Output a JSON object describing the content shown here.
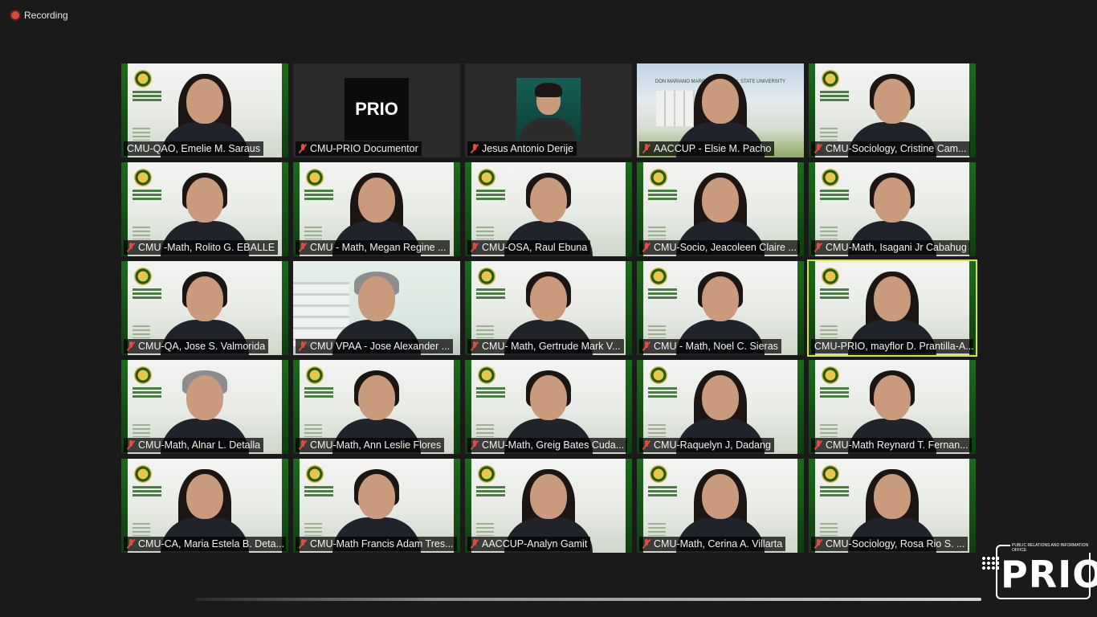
{
  "recording": {
    "label": "Recording"
  },
  "participants": [
    {
      "name": "CMU-QAO, Emelie M. Saraus",
      "muted": false,
      "bg": "vg",
      "hair": "long"
    },
    {
      "name": "CMU-PRIO Documentor",
      "muted": true,
      "bg": "prio"
    },
    {
      "name": "Jesus Antonio Derije",
      "muted": true,
      "bg": "photo"
    },
    {
      "name": "AACCUP - Elsie M. Pacho",
      "muted": true,
      "bg": "campus",
      "hair": "long"
    },
    {
      "name": "CMU-Sociology, Cristine Cam...",
      "muted": true,
      "bg": "vg",
      "hair": "short"
    },
    {
      "name": "CMU -Math, Rolito G. EBALLE",
      "muted": true,
      "bg": "vg",
      "hair": "short"
    },
    {
      "name": "CMU - Math, Megan Regine ...",
      "muted": true,
      "bg": "vg",
      "hair": "long"
    },
    {
      "name": "CMU-OSA, Raul Ebuna",
      "muted": true,
      "bg": "vg",
      "hair": "short"
    },
    {
      "name": "CMU-Socio, Jeacoleen Claire ...",
      "muted": true,
      "bg": "vg",
      "hair": "long"
    },
    {
      "name": "CMU-Math, Isagani Jr Cabahug",
      "muted": true,
      "bg": "vg",
      "hair": "short"
    },
    {
      "name": "CMU-QA, Jose S. Valmorida",
      "muted": true,
      "bg": "vg",
      "hair": "short"
    },
    {
      "name": "CMU VPAA - Jose Alexander ...",
      "muted": true,
      "bg": "room",
      "hair": "grey"
    },
    {
      "name": "CMU- Math, Gertrude Mark V...",
      "muted": true,
      "bg": "vg",
      "hair": "short"
    },
    {
      "name": "CMU - Math, Noel C. Sieras",
      "muted": true,
      "bg": "vg",
      "hair": "short"
    },
    {
      "name": "CMU-PRIO, mayflor D. Prantilla-A...",
      "muted": false,
      "bg": "vg",
      "hair": "long",
      "speaking": true
    },
    {
      "name": "CMU-Math, Alnar L. Detalla",
      "muted": true,
      "bg": "vg",
      "hair": "grey"
    },
    {
      "name": "CMU-Math, Ann Leslie Flores",
      "muted": true,
      "bg": "vg",
      "hair": "short"
    },
    {
      "name": "CMU-Math, Greig Bates Cuda...",
      "muted": true,
      "bg": "vg",
      "hair": "short"
    },
    {
      "name": "CMU-Raquelyn J, Dadang",
      "muted": true,
      "bg": "vg",
      "hair": "long"
    },
    {
      "name": "CMU-Math Reynard T. Fernan...",
      "muted": true,
      "bg": "vg",
      "hair": "short"
    },
    {
      "name": "CMU-CA, Maria Estela B. Deta...",
      "muted": true,
      "bg": "vg",
      "hair": "long"
    },
    {
      "name": "CMU-Math Francis Adam Tres...",
      "muted": true,
      "bg": "vg",
      "hair": "short"
    },
    {
      "name": "AACCUP-Analyn Gamit",
      "muted": true,
      "bg": "vg",
      "hair": "long"
    },
    {
      "name": "CMU-Math, Cerina A. Villarta",
      "muted": true,
      "bg": "vg",
      "hair": "long"
    },
    {
      "name": "CMU-Sociology, Rosa Rio S. ...",
      "muted": true,
      "bg": "vg",
      "hair": "long"
    }
  ],
  "prio_card_text": "PRIO",
  "campus_title": "DON MARIANO MARCOS MEMORIAL STATE UNIVERSITY",
  "watermark": {
    "word": "PRIO",
    "tagline": "PUBLIC RELATIONS AND INFORMATION OFFICE"
  },
  "colors": {
    "speaking_border": "#d9e33b",
    "mute_red": "#e54a3f",
    "vg_green": "#1c6b1c",
    "recording_dot": "#e0463a"
  }
}
